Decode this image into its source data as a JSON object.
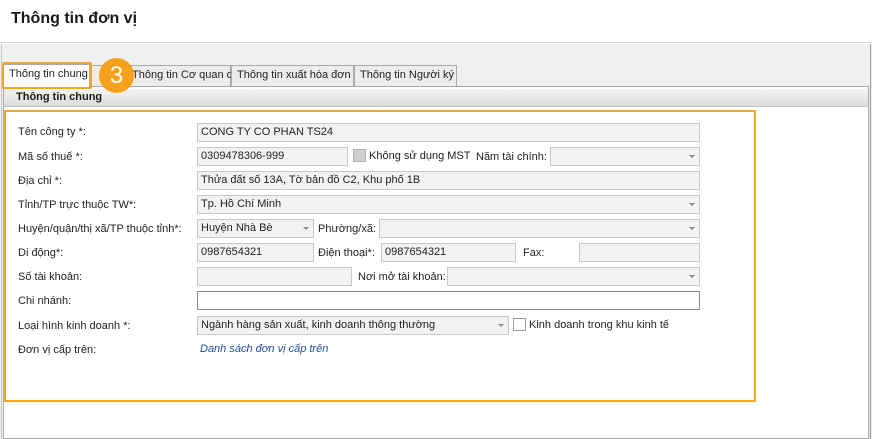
{
  "window": {
    "title": "Thông tin đơn vị"
  },
  "tabs": [
    {
      "label": "Thông tin chung"
    },
    {
      "label": "Thông tin Cơ quan quản lý"
    },
    {
      "label": "Thông tin xuất hóa đơn"
    },
    {
      "label": "Thông tin Người ký"
    }
  ],
  "annotation": {
    "step": "3",
    "color": "#f5a623"
  },
  "group": {
    "title": "Thông tin chung"
  },
  "form": {
    "company_name": {
      "label": "Tên công ty *:",
      "value": "CONG TY CO PHAN TS24"
    },
    "tax_code": {
      "label": "Mã số thuế *:",
      "value": "0309478306-999"
    },
    "no_tax_code": {
      "label": "Không sử dụng MST"
    },
    "fiscal_year": {
      "label": "Năm tài chính:",
      "value": ""
    },
    "address": {
      "label": "Địa chỉ *:",
      "value": "Thửa đất số 13A, Tờ bản đồ C2, Khu phố 1B"
    },
    "province": {
      "label": "Tỉnh/TP trực thuộc TW*:",
      "value": "Tp. Hồ Chí Minh"
    },
    "district": {
      "label": "Huyện/quận/thị xã/TP thuộc tỉnh*:",
      "value": "Huyện Nhà Bè"
    },
    "ward": {
      "label": "Phường/xã:",
      "value": ""
    },
    "mobile": {
      "label": "Di động*:",
      "value": "0987654321"
    },
    "phone": {
      "label": "Điện thoại*:",
      "value": "0987654321"
    },
    "fax": {
      "label": "Fax:",
      "value": ""
    },
    "account_number": {
      "label": "Số tài khoản:",
      "value": ""
    },
    "bank": {
      "label": "Nơi mở tài khoản:",
      "value": ""
    },
    "branch": {
      "label": "Chi nhánh:",
      "value": ""
    },
    "business_type": {
      "label": "Loại hình kinh doanh *:",
      "value": "Ngành hàng sản xuất, kinh doanh thông thường"
    },
    "economic_zone": {
      "label": "Kinh doanh trong khu kinh tế"
    },
    "parent_unit": {
      "label": "Đơn vị cấp trên:",
      "link": "Danh sách đơn vị cấp trên"
    }
  }
}
